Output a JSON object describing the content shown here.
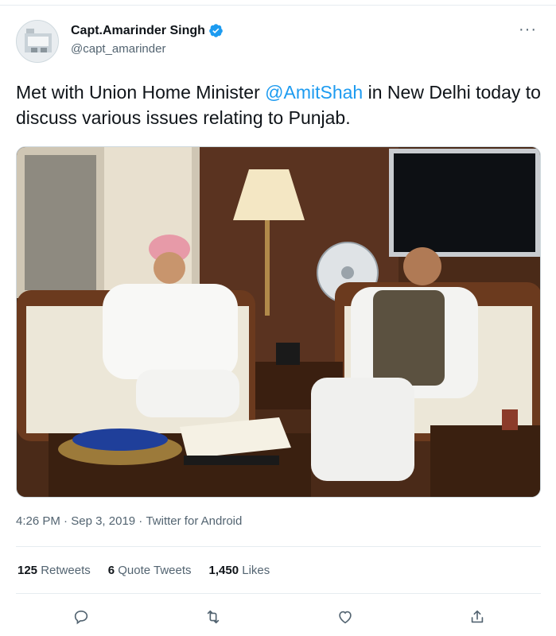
{
  "tweet": {
    "author": {
      "name": "Capt.Amarinder Singh",
      "handle": "@capt_amarinder",
      "verified": true
    },
    "more_label": "···",
    "text_parts": {
      "before": "Met with Union Home Minister ",
      "mention": "@AmitShah",
      "after": " in New Delhi today to discuss various issues relating to Punjab."
    },
    "meta": {
      "time": "4:26 PM",
      "sep1": " · ",
      "date": "Sep 3, 2019",
      "sep2": " · ",
      "source": "Twitter for Android"
    },
    "stats": {
      "retweets_count": "125",
      "retweets_label": "Retweets",
      "quotes_count": "6",
      "quotes_label": "Quote Tweets",
      "likes_count": "1,450",
      "likes_label": "Likes"
    },
    "actions": [
      "reply-icon",
      "retweet-icon",
      "like-icon",
      "share-icon"
    ],
    "colors": {
      "accent": "#1d9bf0",
      "text": "#0f1419",
      "secondary": "#536471",
      "border": "#e6ecf0"
    }
  }
}
